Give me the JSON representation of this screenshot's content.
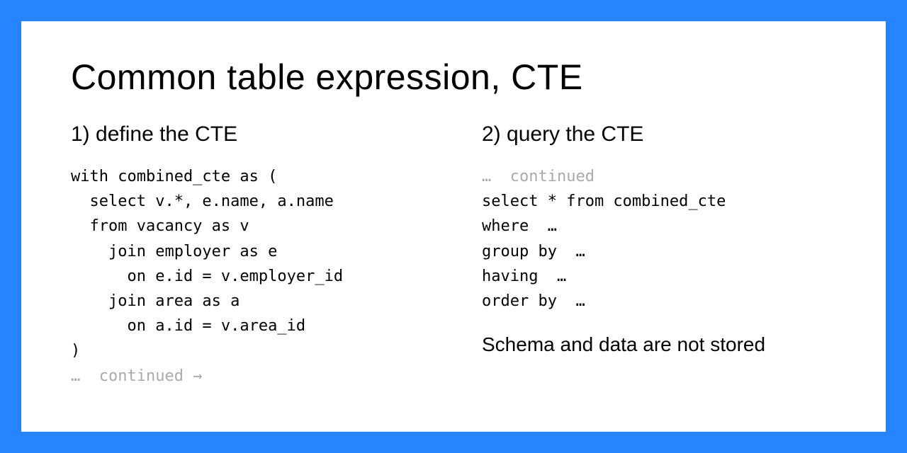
{
  "title": "Common table expression, CTE",
  "left": {
    "heading": "1) define the CTE",
    "code_lines": [
      "with combined_cte as (",
      "  select v.*, e.name, a.name",
      "  from vacancy as v",
      "    join employer as e",
      "      on e.id = v.employer_id",
      "    join area as a",
      "      on a.id = v.area_id",
      ")"
    ],
    "continued_prefix": "…",
    "continued_text": "  continued →"
  },
  "right": {
    "heading": "2) query the CTE",
    "continued_prefix": "…",
    "continued_text": "  continued",
    "code_lines": [
      "select * from combined_cte",
      "where  …",
      "group by  …",
      "having  …",
      "order by  …"
    ],
    "note": "Schema and data are not stored"
  }
}
